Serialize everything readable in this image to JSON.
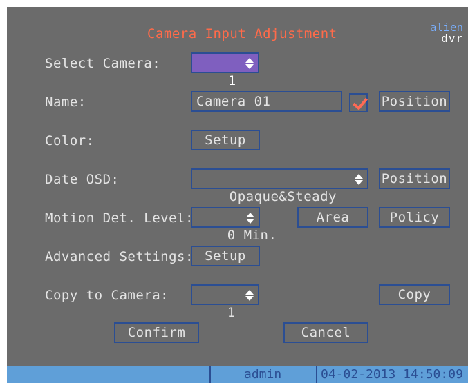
{
  "window": {
    "title": "Camera Input Adjustment"
  },
  "logo": {
    "line1": "alien",
    "line2": "dvr"
  },
  "form": {
    "select_camera": {
      "label": "Select Camera:",
      "value": "1"
    },
    "name": {
      "label": "Name:",
      "value": "Camera 01",
      "checked": true,
      "position_label": "Position"
    },
    "color": {
      "label": "Color:",
      "setup_label": "Setup"
    },
    "date_osd": {
      "label": "Date OSD:",
      "value": "Opaque&Steady",
      "position_label": "Position"
    },
    "motion": {
      "label": "Motion Det. Level:",
      "value": "0 Min.",
      "area_label": "Area",
      "policy_label": "Policy"
    },
    "advanced": {
      "label": "Advanced Settings:",
      "setup_label": "Setup"
    },
    "copy_to": {
      "label": "Copy to Camera:",
      "value": "1",
      "copy_label": "Copy"
    }
  },
  "actions": {
    "confirm_label": "Confirm",
    "cancel_label": "Cancel"
  },
  "statusbar": {
    "user": "admin",
    "datetime": "04-02-2013 14:50:09"
  },
  "colors": {
    "background": "#6b6b6b",
    "border": "#2b4e93",
    "title": "#ff6b4a",
    "selected": "#7f5fbf",
    "statusbar": "#5f9fd8"
  }
}
